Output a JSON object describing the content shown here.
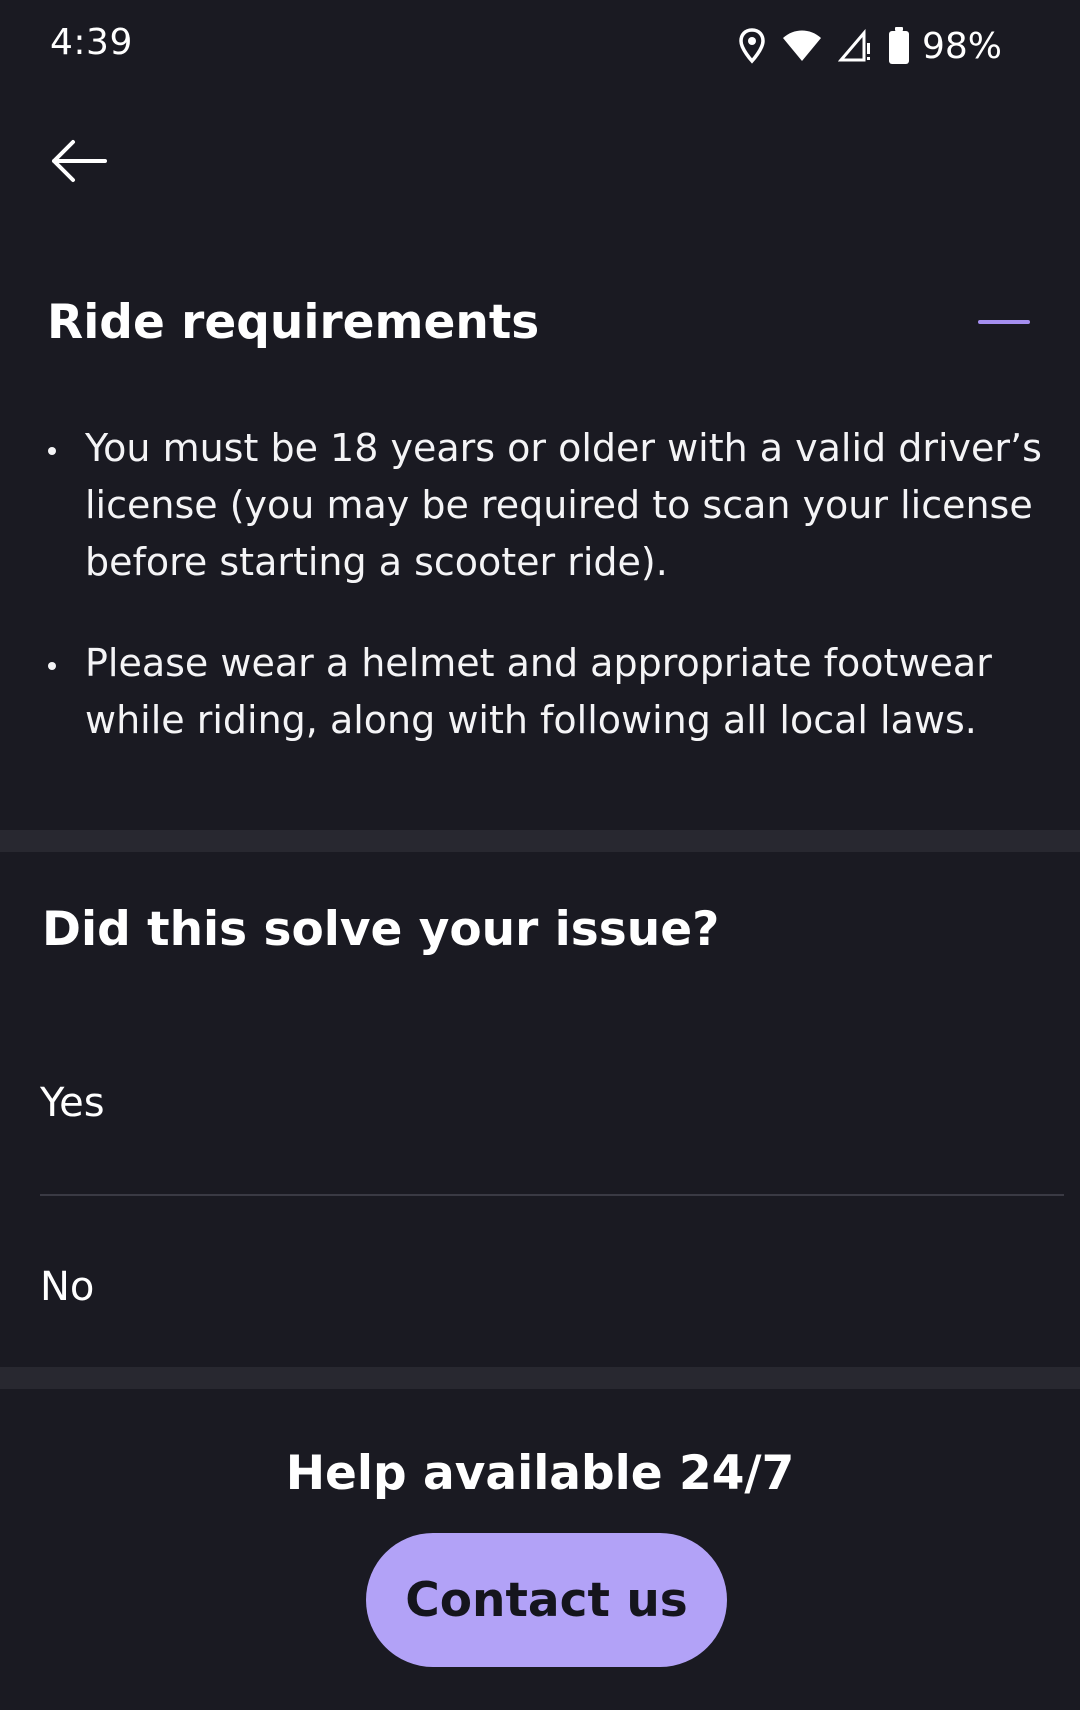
{
  "status_bar": {
    "time": "4:39",
    "battery_percent": "98%",
    "icons": [
      "location-icon",
      "wifi-icon",
      "signal-icon",
      "battery-icon"
    ]
  },
  "nav": {
    "back_icon": "arrow-left-icon"
  },
  "section": {
    "title": "Ride requirements",
    "expanded": true,
    "toggle_icon": "minus-icon",
    "accent_color": "#a58ff0",
    "bullets": [
      "You must be 18 years or older with a valid driver’s license (you may be required to scan your license before starting a scooter ride).",
      "Please wear a helmet and appropriate footwear while riding, along with following all local laws."
    ]
  },
  "feedback": {
    "question": "Did this solve your issue?",
    "options": [
      "Yes",
      "No"
    ]
  },
  "help": {
    "title": "Help available 24/7",
    "contact_label": "Contact us",
    "button_color": "#b2a2f7"
  },
  "colors": {
    "background": "#1a1a22",
    "divider_band": "#282830",
    "text": "#ffffff"
  }
}
